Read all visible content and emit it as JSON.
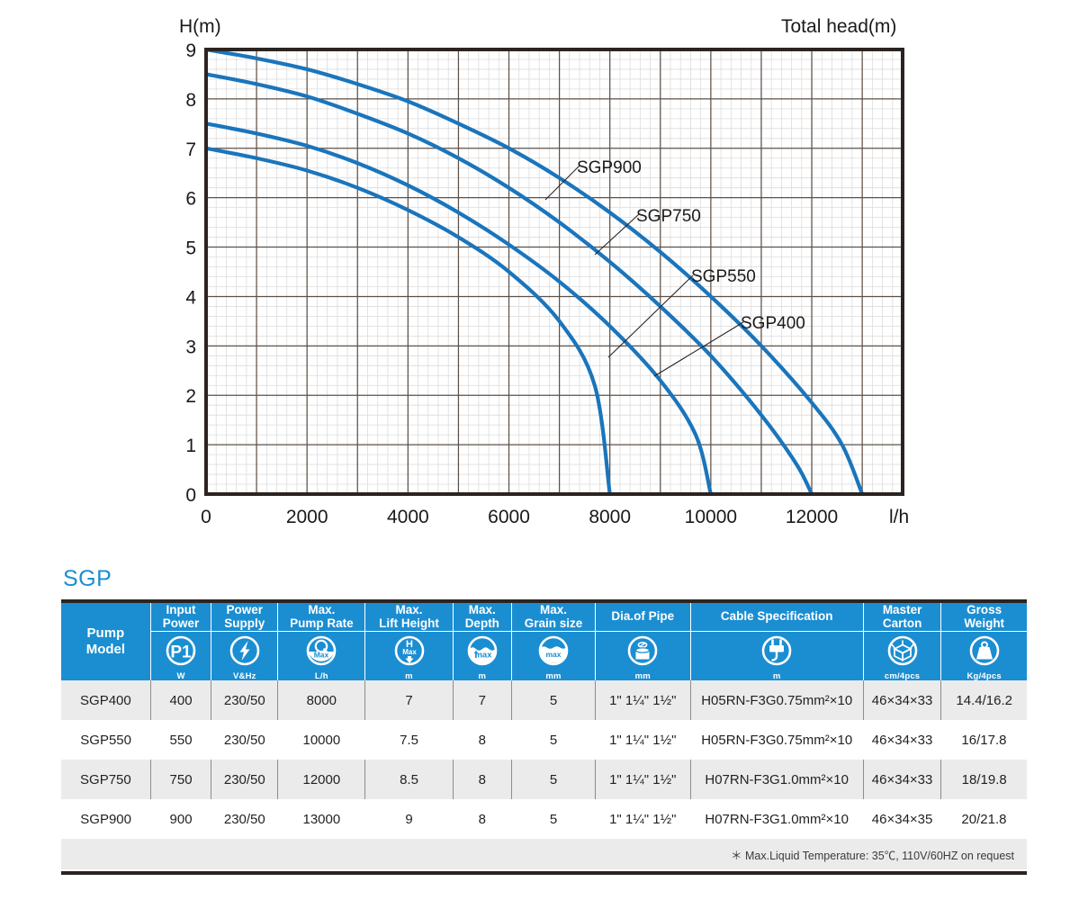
{
  "chart": {
    "y_axis_title": "H(m)",
    "corner_title": "Total head(m)",
    "x_axis_unit": "l/h",
    "x_ticks": [
      "0",
      "2000",
      "4000",
      "6000",
      "8000",
      "10000",
      "12000"
    ],
    "y_ticks": [
      "0",
      "1",
      "2",
      "3",
      "4",
      "5",
      "6",
      "7",
      "8",
      "9"
    ],
    "curve_labels": [
      "SGP900",
      "SGP750",
      "SGP550",
      "SGP400"
    ],
    "line_color": "#1a75bc",
    "grid_major_color": "#4a4039",
    "grid_minor_color": "#d7d7d7",
    "frame_color": "#2b2421"
  },
  "chart_data": {
    "type": "line",
    "title": "Total head(m)",
    "xlabel": "l/h",
    "ylabel": "H(m)",
    "xlim": [
      0,
      13800
    ],
    "ylim": [
      0,
      9
    ],
    "xticks": [
      0,
      2000,
      4000,
      6000,
      8000,
      10000,
      12000
    ],
    "yticks": [
      0,
      1,
      2,
      3,
      4,
      5,
      6,
      7,
      8,
      9
    ],
    "grid": true,
    "minor_grid": true,
    "x_major_step": 1000,
    "y_major_step": 1,
    "minor_subdivisions": 5,
    "legend": "inline-labels",
    "series": [
      {
        "name": "SGP900",
        "color": "#1a75bc",
        "x": [
          0,
          1000,
          2000,
          3000,
          4000,
          5000,
          6000,
          7000,
          8000,
          9000,
          10000,
          11000,
          12000,
          12600,
          13000
        ],
        "y": [
          9.0,
          8.82,
          8.6,
          8.3,
          7.95,
          7.5,
          7.0,
          6.4,
          5.7,
          4.9,
          4.0,
          3.0,
          1.85,
          1.0,
          0.0
        ]
      },
      {
        "name": "SGP750",
        "color": "#1a75bc",
        "x": [
          0,
          1000,
          2000,
          3000,
          4000,
          5000,
          6000,
          7000,
          8000,
          9000,
          10000,
          11000,
          11700,
          12000
        ],
        "y": [
          8.5,
          8.3,
          8.05,
          7.7,
          7.3,
          6.8,
          6.2,
          5.5,
          4.7,
          3.8,
          2.8,
          1.6,
          0.6,
          0.0
        ]
      },
      {
        "name": "SGP550",
        "color": "#1a75bc",
        "x": [
          0,
          1000,
          2000,
          3000,
          4000,
          5000,
          6000,
          7000,
          8000,
          9000,
          9700,
          10000
        ],
        "y": [
          7.5,
          7.3,
          7.05,
          6.7,
          6.25,
          5.7,
          5.05,
          4.3,
          3.4,
          2.3,
          1.2,
          0.0
        ]
      },
      {
        "name": "SGP400",
        "color": "#1a75bc",
        "x": [
          0,
          1000,
          2000,
          3000,
          4000,
          5000,
          6000,
          7000,
          7700,
          8000
        ],
        "y": [
          7.0,
          6.8,
          6.55,
          6.2,
          5.75,
          5.2,
          4.5,
          3.5,
          2.2,
          0.0
        ]
      }
    ]
  },
  "table": {
    "series_title": "SGP",
    "headers": {
      "model": "Pump\nModel",
      "columns": [
        {
          "label": "Input\nPower",
          "line1": "Input",
          "line2": "Power",
          "icon": "p1-power-icon",
          "unit": "W"
        },
        {
          "label": "Power\nSupply",
          "line1": "Power",
          "line2": "Supply",
          "icon": "lightning-bolt-icon",
          "unit": "V&Hz"
        },
        {
          "label": "Max.\nPump Rate",
          "line1": "Max.",
          "line2": "Pump Rate",
          "icon": "q-max-flow-icon",
          "unit": "L/h"
        },
        {
          "label": "Max.\nLift Height",
          "line1": "Max.",
          "line2": "Lift Height",
          "icon": "h-max-lift-icon",
          "unit": "m"
        },
        {
          "label": "Max.\nDepth",
          "line1": "Max.",
          "line2": "Depth",
          "icon": "imax-depth-icon",
          "unit": "m"
        },
        {
          "label": "Max.\nGrain size",
          "line1": "Max.",
          "line2": "Grain size",
          "icon": "grain-max-icon",
          "unit": "mm"
        },
        {
          "label": "Dia.of Pipe",
          "line1": "Dia.of Pipe",
          "line2": "",
          "icon": "pipe-diameter-icon",
          "unit": "mm"
        },
        {
          "label": "Cable Specification",
          "line1": "Cable Specification",
          "line2": "",
          "icon": "power-plug-icon",
          "unit": "m"
        },
        {
          "label": "Master\nCarton",
          "line1": "Master",
          "line2": "Carton",
          "icon": "open-box-icon",
          "unit": "cm/4pcs"
        },
        {
          "label": "Gross\nWeight",
          "line1": "Gross",
          "line2": "Weight",
          "icon": "weight-icon",
          "unit": "Kg/4pcs"
        }
      ]
    },
    "rows": [
      {
        "model": "SGP400",
        "input_power": "400",
        "power_supply": "230/50",
        "max_pump_rate": "8000",
        "max_lift_height": "7",
        "max_depth": "7",
        "max_grain_size": "5",
        "dia_of_pipe": "1\" 1¼\" 1½\"",
        "cable_specification": "H05RN-F3G0.75mm²×10",
        "master_carton": "46×34×33",
        "gross_weight": "14.4/16.2"
      },
      {
        "model": "SGP550",
        "input_power": "550",
        "power_supply": "230/50",
        "max_pump_rate": "10000",
        "max_lift_height": "7.5",
        "max_depth": "8",
        "max_grain_size": "5",
        "dia_of_pipe": "1\" 1¼\" 1½\"",
        "cable_specification": "H05RN-F3G0.75mm²×10",
        "master_carton": "46×34×33",
        "gross_weight": "16/17.8"
      },
      {
        "model": "SGP750",
        "input_power": "750",
        "power_supply": "230/50",
        "max_pump_rate": "12000",
        "max_lift_height": "8.5",
        "max_depth": "8",
        "max_grain_size": "5",
        "dia_of_pipe": "1\" 1¼\" 1½\"",
        "cable_specification": "H07RN-F3G1.0mm²×10",
        "master_carton": "46×34×33",
        "gross_weight": "18/19.8"
      },
      {
        "model": "SGP900",
        "input_power": "900",
        "power_supply": "230/50",
        "max_pump_rate": "13000",
        "max_lift_height": "9",
        "max_depth": "8",
        "max_grain_size": "5",
        "dia_of_pipe": "1\" 1¼\" 1½\"",
        "cable_specification": "H07RN-F3G1.0mm²×10",
        "master_carton": "46×34×35",
        "gross_weight": "20/21.8"
      }
    ],
    "footnote": "＊ Max.Liquid Temperature: 35℃, 110V/60HZ on request",
    "header_color": "#1b8ed2",
    "shaded_row_color": "#ebebeb"
  }
}
